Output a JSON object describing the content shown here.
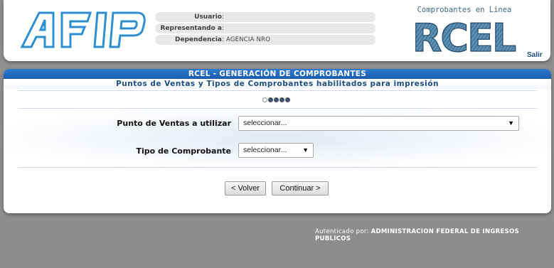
{
  "header": {
    "afip_logo_text": "AFIP",
    "user_info": [
      {
        "label": "Usuario",
        "value": ""
      },
      {
        "label": "Representando a",
        "value": ""
      },
      {
        "label": "Dependencia",
        "value": "AGENCIA NRO"
      }
    ],
    "rcel_tagline": "Comprobantes en Linea",
    "rcel_logo_text": "RCEL",
    "salir_label": "Salir"
  },
  "main": {
    "title": "RCEL - GENERACIÓN DE COMPROBANTES",
    "subtitle": "Puntos de Ventas y Tipos de Comprobantes habilitados para impresión",
    "steps": {
      "total": 5,
      "current": 1
    },
    "punto_de_ventas": {
      "label": "Punto de Ventas a utilizar",
      "value": "seleccionar..."
    },
    "tipo_comprobante": {
      "label": "Tipo de Comprobante",
      "value": "seleccionar..."
    },
    "back_button": "< Volver",
    "continue_button": "Continuar >"
  },
  "footer": {
    "auth_label": "Autenticado por:",
    "auth_org": "ADMINISTRACION FEDERAL DE INGRESOS PUBLICOS"
  },
  "colors": {
    "title_bar": "#1b5cae",
    "subtitle_text": "#1d4f82",
    "background": "#8d8d8d",
    "afip_logo": "#2e8fd0"
  }
}
